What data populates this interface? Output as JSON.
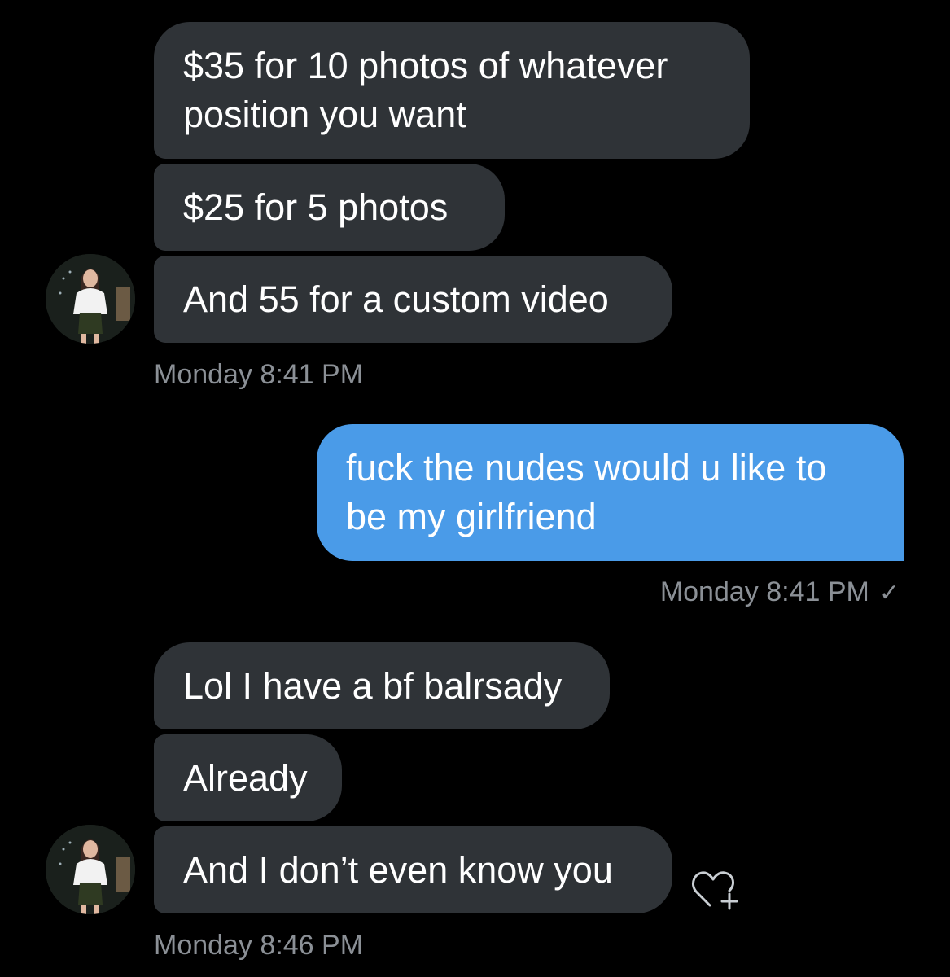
{
  "messages": [
    {
      "sender": "them",
      "text": "$35 for 10 photos of whatever position you want"
    },
    {
      "sender": "them",
      "text": "$25 for 5 photos"
    },
    {
      "sender": "them",
      "text": "And 55 for a custom video"
    },
    {
      "sender": "me",
      "text": "fuck the nudes would u like to be my girlfriend"
    },
    {
      "sender": "them",
      "text": "Lol I have a bf balrsady"
    },
    {
      "sender": "them",
      "text": "Already"
    },
    {
      "sender": "them",
      "text": "And I don’t even know you"
    }
  ],
  "timestamps": {
    "group1": "Monday 8:41 PM",
    "group2": "Monday 8:41 PM",
    "group3": "Monday 8:46 PM"
  },
  "icons": {
    "read_receipt": "checkmark-icon",
    "like_button": "heart-plus-icon",
    "avatar": "contact-avatar-photo"
  },
  "colors": {
    "background": "#000000",
    "incoming_bubble": "#2f3337",
    "outgoing_bubble": "#4a9be8",
    "timestamp_text": "#8b9096"
  }
}
